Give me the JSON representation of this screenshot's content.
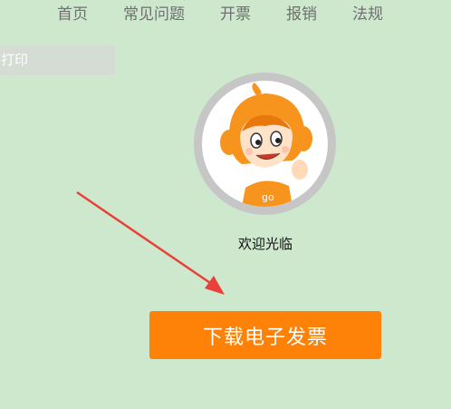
{
  "nav": {
    "items": [
      {
        "label": "首页"
      },
      {
        "label": "常见问题"
      },
      {
        "label": "开票"
      },
      {
        "label": "报销"
      },
      {
        "label": "法规"
      }
    ]
  },
  "sidebar": {
    "tab_label": "打印"
  },
  "avatar": {
    "badge_text": "go"
  },
  "welcome_text": "欢迎光临",
  "download_button": {
    "label": "下载电子发票"
  },
  "colors": {
    "background": "#cde8cc",
    "button": "#ff8208",
    "arrow": "#e8413a",
    "mascot_orange": "#f7941d"
  },
  "icons": {
    "arrow": "red-arrow-icon",
    "mascot": "mascot-avatar-icon"
  }
}
